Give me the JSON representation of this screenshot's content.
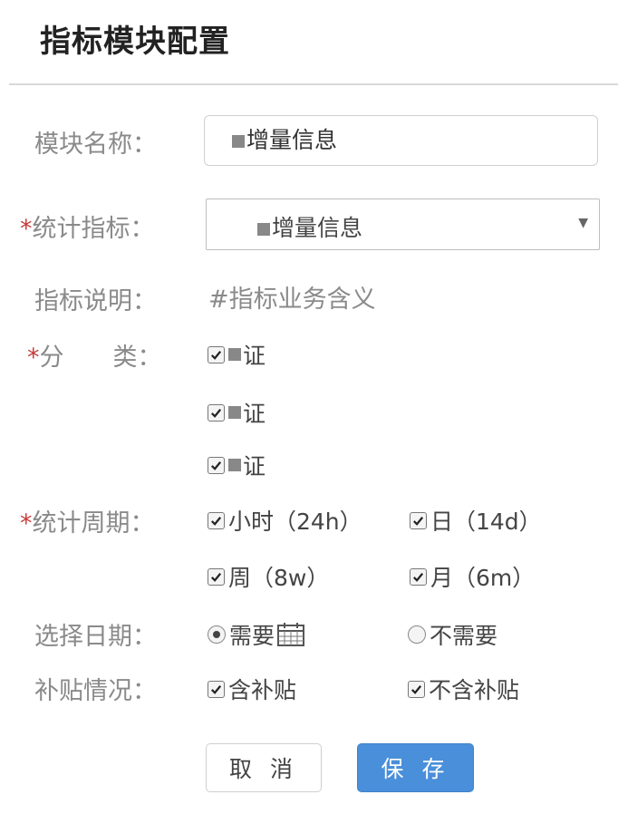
{
  "page": {
    "title": "指标模块配置"
  },
  "labels": {
    "module_name": "模块名称：",
    "stat_indicator": "统计指标：",
    "indicator_desc": "指标说明：",
    "category": "分　　类：",
    "stat_period": "统计周期：",
    "select_date": "选择日期：",
    "subsidy": "补贴情况："
  },
  "required_mark": "*",
  "module_name_value": "增量信息",
  "stat_indicator_value": "增量信息",
  "indicator_description": "#指标业务含义",
  "categories": [
    {
      "label": "证",
      "checked": true
    },
    {
      "label": "证",
      "checked": true
    },
    {
      "label": "证",
      "checked": true
    }
  ],
  "periods": [
    {
      "label": "小时（24h）",
      "checked": true
    },
    {
      "label": "日（14d）",
      "checked": true
    },
    {
      "label": "周（8w）",
      "checked": true
    },
    {
      "label": "月（6m）",
      "checked": true
    }
  ],
  "date_options": [
    {
      "label": "需要",
      "selected": true
    },
    {
      "label": "不需要",
      "selected": false
    }
  ],
  "subsidy_options": [
    {
      "label": "含补贴",
      "checked": true
    },
    {
      "label": "不含补贴",
      "checked": true
    }
  ],
  "buttons": {
    "cancel": "取 消",
    "save": "保 存"
  },
  "colors": {
    "primary": "#4a8fd9",
    "required": "#c83c3c",
    "label": "#8a8a8a"
  }
}
